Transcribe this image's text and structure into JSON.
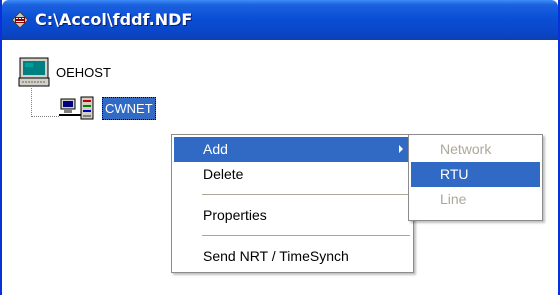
{
  "window": {
    "title": "C:\\Accol\\fddf.NDF",
    "icon": "network-document-icon"
  },
  "tree": {
    "root": {
      "label": "OEHOST",
      "icon": "computer-icon"
    },
    "child": {
      "label": "CWNET",
      "icon": "network-icon",
      "selected": true
    }
  },
  "context_menu": {
    "items": [
      {
        "label": "Add",
        "highlighted": true,
        "has_submenu": true
      },
      {
        "label": "Delete"
      },
      {
        "label": "Properties"
      },
      {
        "label": "Send NRT / TimeSynch"
      }
    ]
  },
  "submenu": {
    "items": [
      {
        "label": "Network",
        "enabled": false
      },
      {
        "label": "RTU",
        "enabled": true,
        "highlighted": true
      },
      {
        "label": "Line",
        "enabled": false
      }
    ]
  },
  "colors": {
    "titlebar": "#0a4fd6",
    "highlight": "#316ac5",
    "disabled_text": "#aca899",
    "border": "#0831d9"
  }
}
